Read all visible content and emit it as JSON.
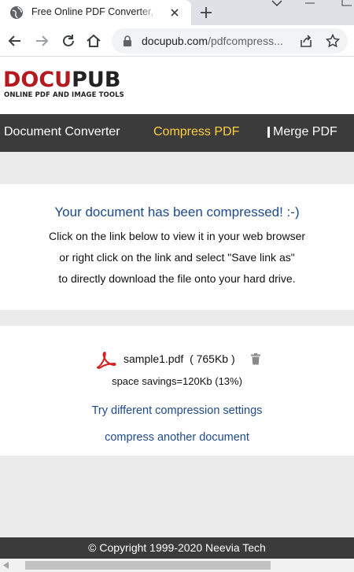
{
  "browser": {
    "tab_title": "Free Online PDF Converter, Batch",
    "url_host": "docupub.com",
    "url_path": "/pdfcompress..."
  },
  "site": {
    "logo_part1": "DOCU",
    "logo_part2": "PUB",
    "tagline": "ONLINE PDF AND IMAGE TOOLS",
    "brand_color": "#b3191f"
  },
  "menu": {
    "items": [
      "Document Converter",
      "Compress PDF",
      "Merge PDF"
    ],
    "active_index": 1,
    "active_color": "#ffd040"
  },
  "result": {
    "title": "Your document has been compressed! :-)",
    "lines": [
      "Click on the link below to view it in your web browser",
      "or right click on the link and select \"Save link as\"",
      "to directly download the file onto your hard drive."
    ]
  },
  "file": {
    "name": "sample1.pdf",
    "size": "( 765Kb )",
    "savings": "space savings=120Kb (13%)",
    "icon": "pdf-icon"
  },
  "links": {
    "retry": "Try different compression settings",
    "another": "compress another document"
  },
  "footer": {
    "copyright": "© Copyright 1999-2020 Neevia Tech"
  }
}
